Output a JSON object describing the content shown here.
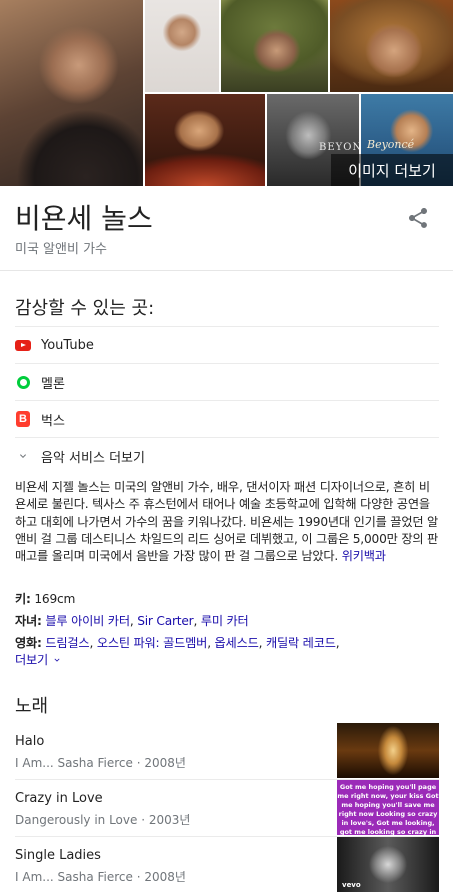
{
  "images": {
    "more_label": "이미지 더보기",
    "tile_text_6": "BEYONCÉ",
    "tile_text_7": "Beyoncé"
  },
  "header": {
    "title": "비욘세 놀스",
    "subtitle": "미국 알앤비 가수",
    "share_icon": "share-icon"
  },
  "listen": {
    "heading": "감상할 수 있는 곳:",
    "services": [
      {
        "label": "YouTube",
        "icon": "youtube-icon",
        "color": "#e62117"
      },
      {
        "label": "멜론",
        "icon": "melon-icon",
        "color": "#00cd3c"
      },
      {
        "label": "벅스",
        "icon": "bugs-icon",
        "color": "#ff3d2e",
        "glyph": "B"
      }
    ],
    "more_label": "음악 서비스 더보기"
  },
  "description": {
    "text": "비욘세 지젤 놀스는 미국의 알앤비 가수, 배우, 댄서이자 패션 디자이너으로, 흔히 비욘세로 불린다. 텍사스 주 휴스턴에서 태어나 예술 초등학교에 입학해 다양한 공연을 하고 대회에 나가면서 가수의 꿈을 키워나갔다. 비욘세는 1990년대 인기를 끌었던 알앤비 걸 그룹 데스티니스 차일드의 리드 싱어로 데뷔했고, 이 그룹은 5,000만 장의 판매고를 올리며 미국에서 음반을 가장 많이 판 걸 그룹으로 남았다.",
    "source_link": "위키백과"
  },
  "facts": {
    "height_label": "키:",
    "height_value": "169cm",
    "children_label": "자녀:",
    "children": [
      "블루 아이비 카터",
      "Sir Carter",
      "루미 카터"
    ],
    "movies_label": "영화:",
    "movies": [
      "드림걸스",
      "오스틴 파워: 골드멤버",
      "옵세스드",
      "캐딜락 레코드"
    ],
    "more_label": "더보기"
  },
  "songs": {
    "heading": "노래",
    "items": [
      {
        "name": "Halo",
        "meta": "I Am... Sasha Fierce · 2008년"
      },
      {
        "name": "Crazy in Love",
        "meta": "Dangerously in Love · 2003년",
        "thumb_text": "Got me hoping you'll page me right now, your kiss Got me hoping you'll save me right now Looking so crazy in love's, Got me looking, got me looking so crazy in love"
      },
      {
        "name": "Single Ladies",
        "meta": "I Am... Sasha Fierce · 2008년",
        "thumb_text": "vevo"
      }
    ]
  },
  "colors": {
    "link": "#1a0dab",
    "secondary_text": "#70757a",
    "divider": "#ebebeb"
  }
}
